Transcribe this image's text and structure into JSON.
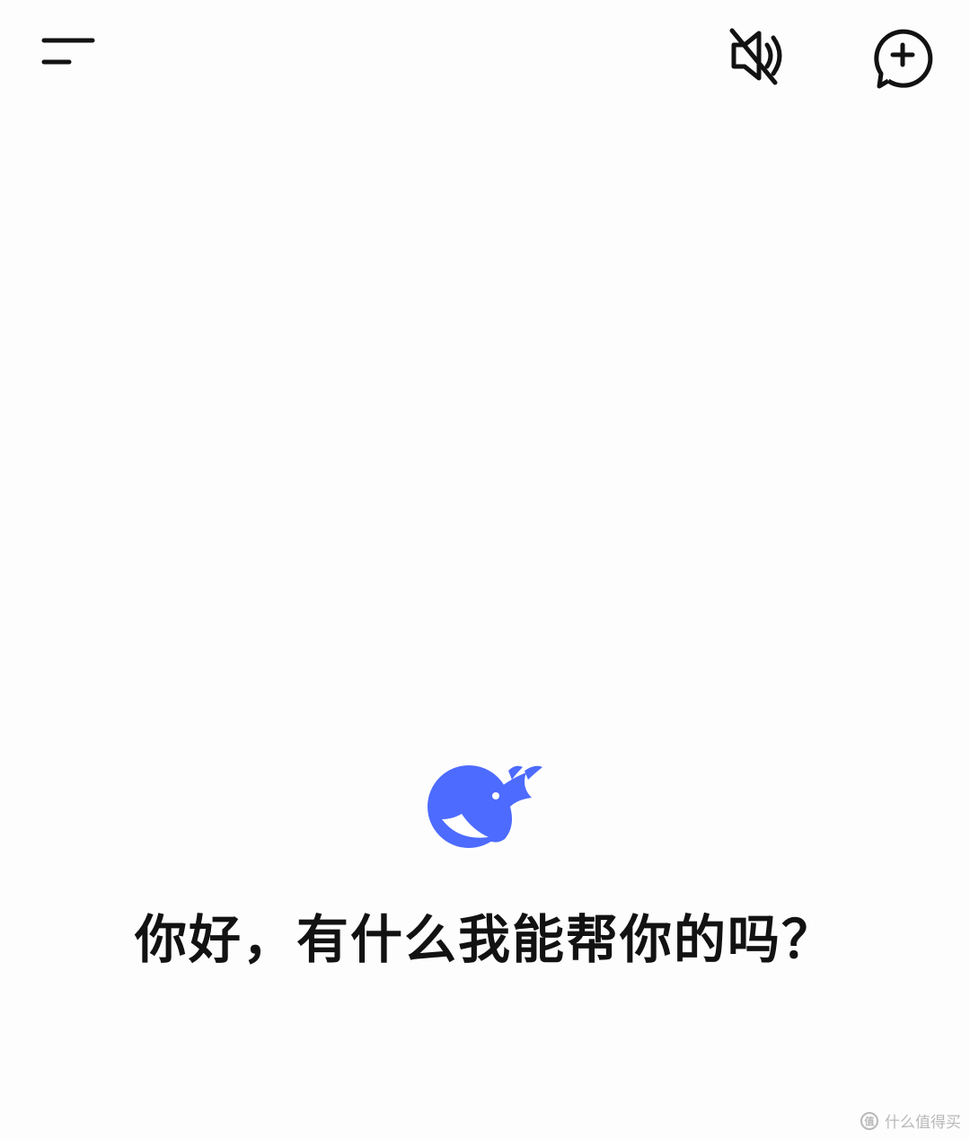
{
  "app": {
    "accent_color": "#4D6BFE",
    "text_color": "#121212",
    "background_color": "#FDFDFE"
  },
  "top_bar": {
    "menu_icon": "hamburger-menu-icon",
    "mute_icon": "speaker-muted-icon",
    "new_chat_icon": "new-chat-plus-icon"
  },
  "welcome": {
    "logo_icon": "whale-logo-icon",
    "greeting": "你好，有什么我能帮你的吗？"
  },
  "watermark": {
    "text": "什么值得买",
    "icon": "smzdm-logo-icon"
  }
}
